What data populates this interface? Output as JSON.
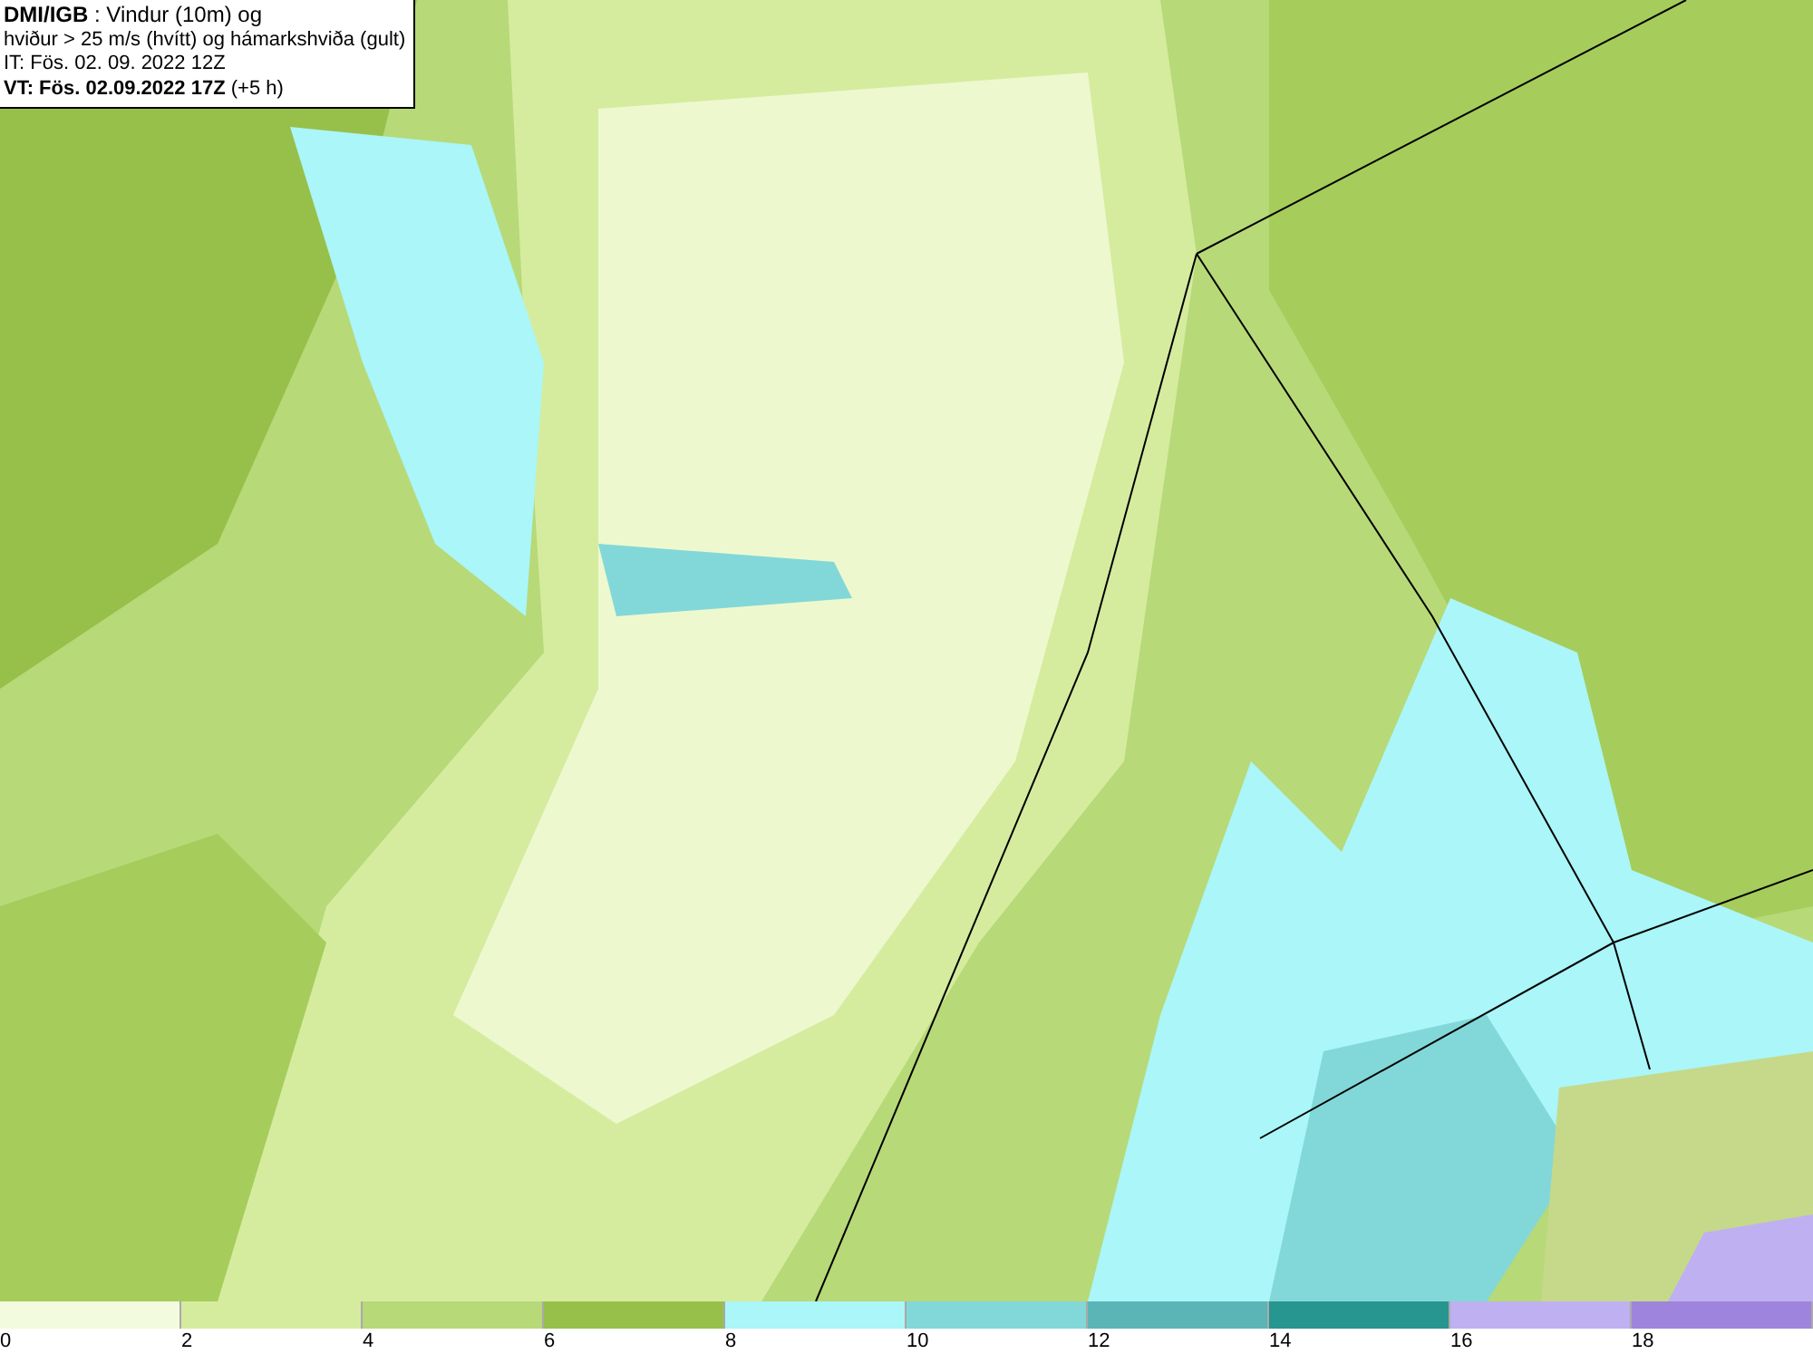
{
  "info_box": {
    "lines": [
      "**DMI/IGB** : Vindur (10m) og",
      "hviður > 25 m/s (hvítt) og hámarkshviða (gult)",
      "IT: Fös. 02. 09. 2022 12Z",
      "**VT: Fös. 02.09.2022 17Z** (+5 h)"
    ]
  },
  "legend": {
    "bins": [
      {
        "color": "#f3fbdf"
      },
      {
        "color": "#d5ec9f"
      },
      {
        "color": "#b7d978"
      },
      {
        "color": "#97c04a"
      },
      {
        "color": "#aaf6f8"
      },
      {
        "color": "#82d8d8"
      },
      {
        "color": "#5bb5b6"
      },
      {
        "color": "#279590"
      },
      {
        "color": "#bfb0f2"
      },
      {
        "color": "#9e84dc"
      }
    ],
    "ticks": [
      "0",
      "2",
      "4",
      "6",
      "8",
      "10",
      "12",
      "14",
      "16",
      "18"
    ]
  }
}
